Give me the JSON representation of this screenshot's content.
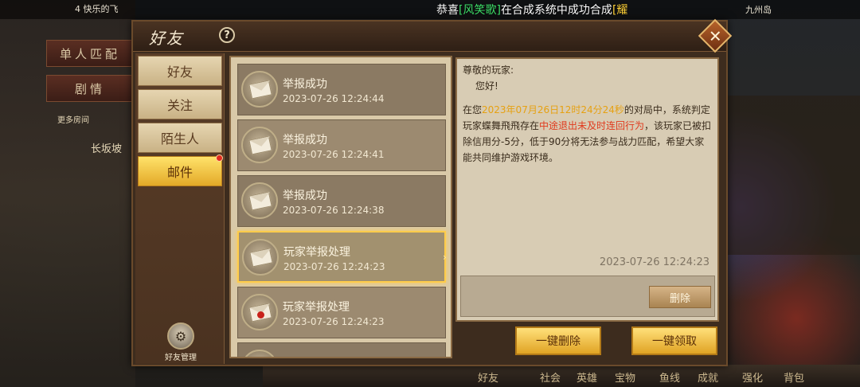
{
  "background": {
    "player_info": "4  快乐的飞",
    "map_name": "九州岛",
    "left_buttons": [
      "单人匹配",
      "剧情"
    ],
    "side_texts": [
      "长坂坡",
      "更多房间"
    ],
    "announcement": {
      "prefix": "恭喜",
      "player": "[风笑歌]",
      "middle": "在合成系统中成功合成",
      "item": "[耀"
    },
    "bottom_bar": [
      "好友",
      "社会",
      "英雄",
      "宝物",
      "鱼线",
      "成就",
      "强化",
      "背包"
    ]
  },
  "dialog": {
    "title": "好友",
    "help_label": "?",
    "close_label": "✕",
    "nav_tabs": [
      {
        "label": "好友",
        "active": false
      },
      {
        "label": "关注",
        "active": false
      },
      {
        "label": "陌生人",
        "active": false
      },
      {
        "label": "邮件",
        "active": true
      }
    ],
    "friend_management_label": "好友管理",
    "mails": [
      {
        "title": "举报成功",
        "time": "2023-07-26 12:24:44",
        "sealed": false
      },
      {
        "title": "举报成功",
        "time": "2023-07-26 12:24:41",
        "sealed": false
      },
      {
        "title": "举报成功",
        "time": "2023-07-26 12:24:38",
        "sealed": false
      },
      {
        "title": "玩家举报处理",
        "time": "2023-07-26 12:24:23",
        "sealed": false,
        "selected": true
      },
      {
        "title": "玩家举报处理",
        "time": "2023-07-26 12:24:23",
        "sealed": true
      }
    ],
    "detail": {
      "greeting": "尊敬的玩家:",
      "hello": "您好!",
      "body_1": "在您",
      "body_time": "2023年07月26日12时24分24秒",
      "body_2": "的对局中，系统判定玩家蝶舞飛飛存在",
      "body_violation": "中途退出未及时连回行为",
      "body_3": "，该玩家已被扣除信用分-5分，低于90分将无法参与战力匹配，希望大家能共同维护游戏环境。",
      "date": "2023-07-26 12:24:23",
      "delete_label": "删除"
    },
    "delete_all_label": "一键删除",
    "claim_all_label": "一键领取",
    "colors": {
      "active_tab": "#ffd24a",
      "highlight_yellow": "#e6a112",
      "highlight_red": "#e03a1e",
      "selected_border": "#ffcc4a"
    }
  }
}
